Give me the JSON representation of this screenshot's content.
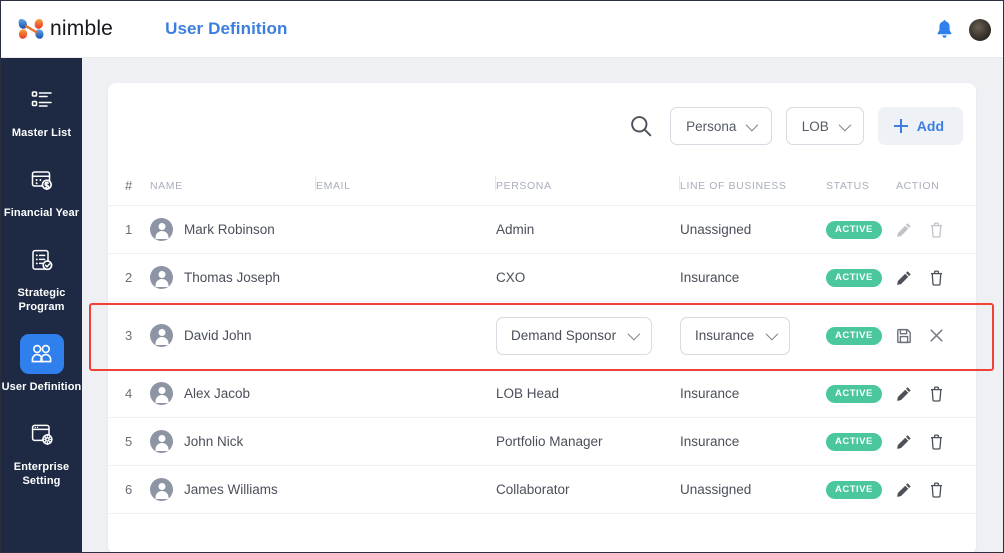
{
  "brand": {
    "name": "nimble",
    "logo_icon": "nimble-logo-icon"
  },
  "header": {
    "title": "User Definition",
    "title_color": "#3b7ee0",
    "bell_icon": "bell-icon",
    "bell_color": "#2f80ed",
    "avatar_icon": "user-avatar-icon"
  },
  "sidebar": {
    "bg_color": "#1e2a44",
    "active_color": "#2f80ed",
    "items": [
      {
        "label": "Master List",
        "icon": "list-icon",
        "active": false
      },
      {
        "label": "Financial Year",
        "icon": "calendar-dollar-icon",
        "active": false
      },
      {
        "label": "Strategic Program",
        "icon": "clipboard-check-icon",
        "active": false
      },
      {
        "label": "User Definition",
        "icon": "users-icon",
        "active": true
      },
      {
        "label": "Enterprise Setting",
        "icon": "window-gear-icon",
        "active": false
      }
    ]
  },
  "toolbar": {
    "search_icon": "search-icon",
    "persona_filter": "Persona",
    "lob_filter": "LOB",
    "add_label": "Add",
    "add_icon": "plus-icon",
    "add_color": "#3b7ee0"
  },
  "table": {
    "columns": [
      "#",
      "NAME",
      "EMAIL",
      "PERSONA",
      "LINE OF BUSINESS",
      "STATUS",
      "ACTION"
    ],
    "rows": [
      {
        "num": "1",
        "name": "Mark Robinson",
        "email": "",
        "persona": "Admin",
        "lob": "Unassigned",
        "status": "ACTIVE",
        "editing": false,
        "actions_disabled": true
      },
      {
        "num": "2",
        "name": "Thomas Joseph",
        "email": "",
        "persona": "CXO",
        "lob": "Insurance",
        "status": "ACTIVE",
        "editing": false,
        "actions_disabled": false
      },
      {
        "num": "3",
        "name": "David John",
        "email": "",
        "persona": "Demand Sponsor",
        "lob": "Insurance",
        "status": "ACTIVE",
        "editing": true,
        "actions_disabled": false
      },
      {
        "num": "4",
        "name": "Alex Jacob",
        "email": "",
        "persona": "LOB Head",
        "lob": "Insurance",
        "status": "ACTIVE",
        "editing": false,
        "actions_disabled": false
      },
      {
        "num": "5",
        "name": "John Nick",
        "email": "",
        "persona": "Portfolio Manager",
        "lob": "Insurance",
        "status": "ACTIVE",
        "editing": false,
        "actions_disabled": false
      },
      {
        "num": "6",
        "name": "James Williams",
        "email": "",
        "persona": "Collaborator",
        "lob": "Unassigned",
        "status": "ACTIVE",
        "editing": false,
        "actions_disabled": false
      }
    ],
    "row_icons": {
      "edit": "pencil-icon",
      "delete": "trash-icon",
      "save": "save-icon",
      "cancel": "close-icon"
    },
    "status_color": "#4ac79c"
  },
  "annotation": {
    "highlight_color": "#ef4136",
    "target_row": "3"
  }
}
